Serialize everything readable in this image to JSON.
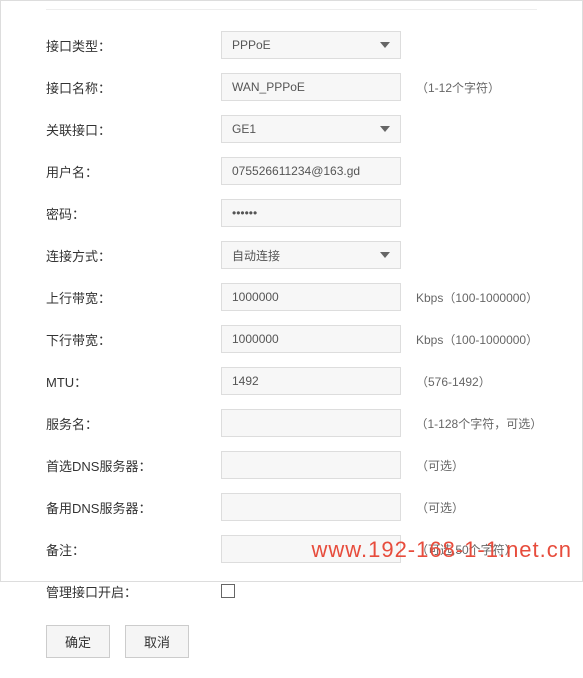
{
  "form": {
    "interface_type": {
      "label": "接口类型：",
      "value": "PPPoE"
    },
    "interface_name": {
      "label": "接口名称：",
      "value": "WAN_PPPoE",
      "hint": "（1-12个字符）"
    },
    "associated_interface": {
      "label": "关联接口：",
      "value": "GE1"
    },
    "username": {
      "label": "用户名：",
      "value": "075526611234@163.gd"
    },
    "password": {
      "label": "密码：",
      "value": "••••••"
    },
    "connection_mode": {
      "label": "连接方式：",
      "value": "自动连接"
    },
    "upstream": {
      "label": "上行带宽：",
      "value": "1000000",
      "hint": "Kbps（100-1000000）"
    },
    "downstream": {
      "label": "下行带宽：",
      "value": "1000000",
      "hint": "Kbps（100-1000000）"
    },
    "mtu": {
      "label": "MTU：",
      "value": "1492",
      "hint": "（576-1492）"
    },
    "service_name": {
      "label": "服务名：",
      "value": "",
      "hint": "（1-128个字符，可选）"
    },
    "primary_dns": {
      "label": "首选DNS服务器：",
      "value": "",
      "hint": "（可选）"
    },
    "secondary_dns": {
      "label": "备用DNS服务器：",
      "value": "",
      "hint": "（可选）"
    },
    "remark": {
      "label": "备注：",
      "value": "",
      "hint": "（可选,50个字符）"
    },
    "mgmt_port": {
      "label": "管理接口开启："
    }
  },
  "buttons": {
    "ok": "确定",
    "cancel": "取消"
  },
  "watermark": "www.192-168-1-1.net.cn"
}
